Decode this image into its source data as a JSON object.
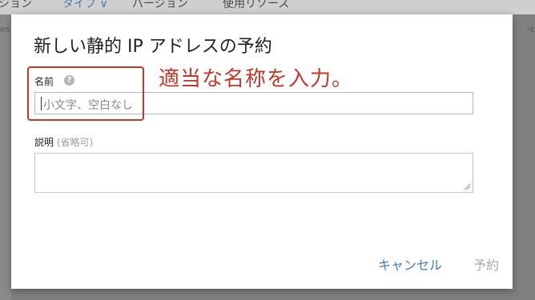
{
  "background": {
    "header_items": [
      "ション",
      "タイプ ∨",
      "バージョン",
      "使用リソース"
    ],
    "left_fragment": "es",
    "right_fragment": "-c"
  },
  "dialog": {
    "title": "新しい静的 IP アドレスの予約",
    "name_label": "名前",
    "name_help_icon": "?",
    "name_placeholder": "小文字、空白なし",
    "name_value": "",
    "description_label": "説明",
    "description_optional": "(省略可)",
    "description_value": "",
    "cancel_label": "キャンセル",
    "reserve_label": "予約"
  },
  "annotation": {
    "text": "適当な名称を入力。",
    "color": "#c0392b"
  },
  "colors": {
    "link": "#3f7fbf",
    "disabled": "#a8a8a8",
    "overlay": "#7f7f7f"
  }
}
